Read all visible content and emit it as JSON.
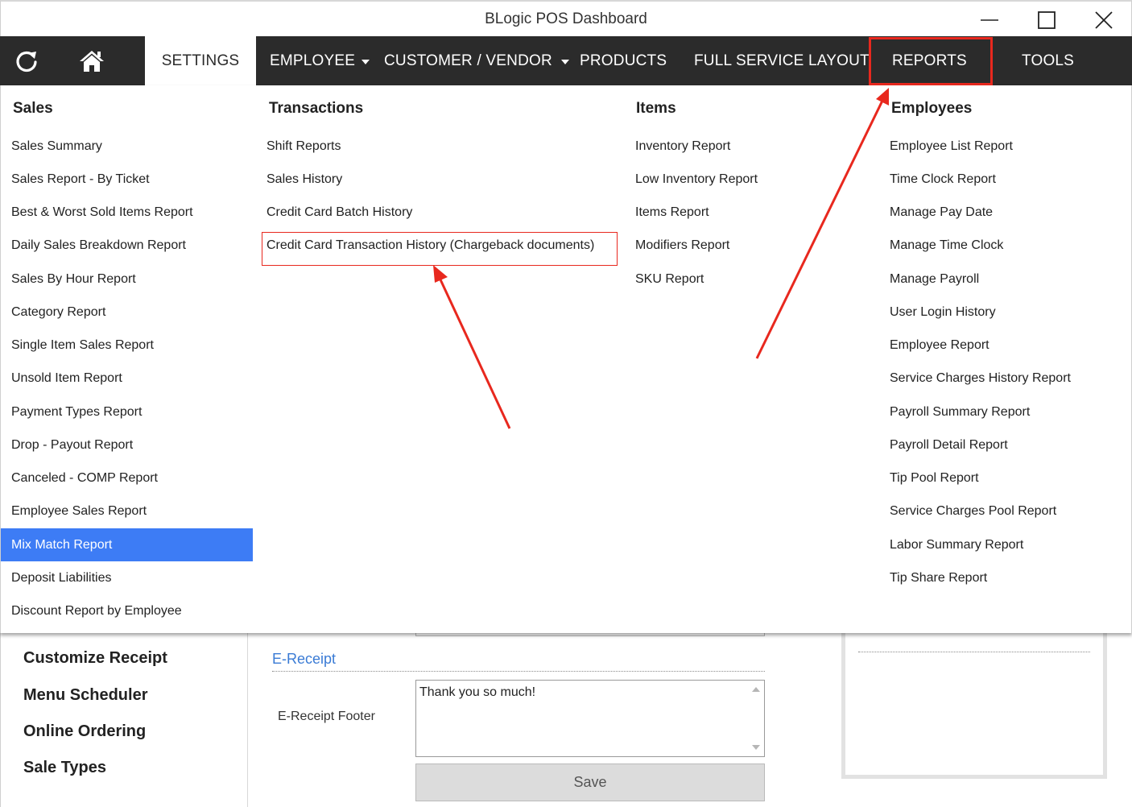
{
  "window": {
    "title": "BLogic POS Dashboard"
  },
  "nav": {
    "items": [
      {
        "label": "SETTINGS"
      },
      {
        "label": "EMPLOYEE"
      },
      {
        "label": "CUSTOMER / VENDOR"
      },
      {
        "label": "PRODUCTS"
      },
      {
        "label": "FULL SERVICE LAYOUT"
      },
      {
        "label": "REPORTS"
      },
      {
        "label": "TOOLS"
      }
    ]
  },
  "reports_menu": {
    "columns": [
      {
        "heading": "Sales",
        "items": [
          "Sales Summary",
          "Sales Report - By Ticket",
          "Best & Worst Sold Items Report",
          "Daily Sales Breakdown Report",
          "Sales By Hour Report",
          "Category Report",
          "Single Item Sales Report",
          "Unsold Item Report",
          "Payment Types Report",
          "Drop - Payout Report",
          "Canceled - COMP Report",
          "Employee Sales Report",
          "Mix Match Report",
          "Deposit Liabilities",
          "Discount Report by Employee"
        ]
      },
      {
        "heading": "Transactions",
        "items": [
          "Shift Reports",
          "Sales History",
          "Credit Card Batch History",
          "Credit Card Transaction History (Chargeback documents)"
        ]
      },
      {
        "heading": "Items",
        "items": [
          "Inventory Report",
          "Low Inventory Report",
          "Items Report",
          "Modifiers Report",
          "SKU Report"
        ]
      },
      {
        "heading": "Employees",
        "items": [
          "Employee List Report",
          "Time Clock Report",
          "Manage Pay Date",
          "Manage Time Clock",
          "Manage Payroll",
          "User Login History",
          "Employee Report",
          "Service Charges History Report",
          "Payroll Summary Report",
          "Payroll Detail Report",
          "Tip Pool Report",
          "Service Charges Pool Report",
          "Labor Summary Report",
          "Tip Share Report"
        ]
      }
    ]
  },
  "background_page": {
    "sidebar": [
      "Customize Receipt",
      "Menu Scheduler",
      "Online Ordering",
      "Sale Types"
    ],
    "section_title": "E-Receipt",
    "field_label": "E-Receipt Footer",
    "footer_value": "Thank you so much!",
    "save_label": "Save"
  },
  "colors": {
    "nav_bg": "#2b2b2b",
    "selected_item": "#3d7cf5",
    "annotation": "#e8281e",
    "section_link": "#3a7bd5"
  }
}
